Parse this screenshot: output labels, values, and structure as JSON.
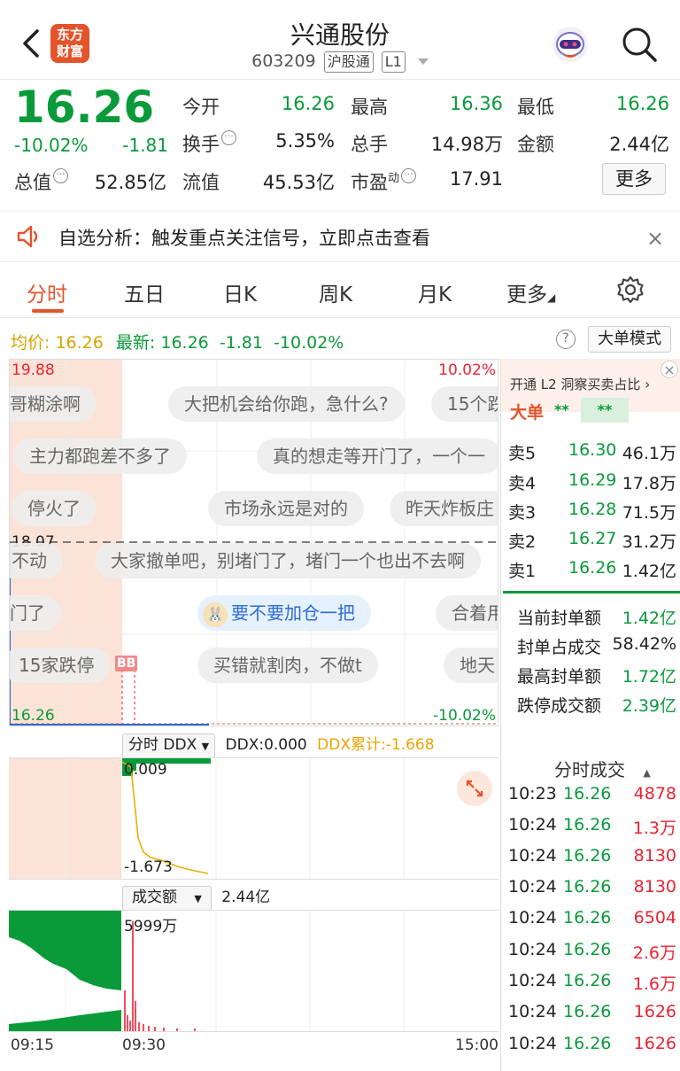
{
  "header": {
    "logo_text_1": "东方",
    "logo_text_2": "财富",
    "stock_name": "兴通股份",
    "stock_code": "603209",
    "tag_connect": "沪股通",
    "tag_level": "L1"
  },
  "quote": {
    "price": "16.26",
    "pct_change": "-10.02%",
    "change": "-1.81",
    "fields": [
      {
        "label": "今开",
        "value": "16.26"
      },
      {
        "label": "最高",
        "value": "16.36"
      },
      {
        "label": "最低",
        "value": "16.26"
      },
      {
        "label": "换手",
        "value": "5.35%"
      },
      {
        "label": "总手",
        "value": "14.98万"
      },
      {
        "label": "金额",
        "value": "2.44亿"
      },
      {
        "label": "总值",
        "value": "52.85亿"
      },
      {
        "label": "流值",
        "value": "45.53亿"
      },
      {
        "label": "市盈",
        "value": "17.91"
      }
    ],
    "pe_sup": "动",
    "more_label": "更多"
  },
  "alert": {
    "text": "自选分析：触发重点关注信号，立即点击查看",
    "close": "×"
  },
  "tabs": [
    {
      "label": "分时",
      "active": true
    },
    {
      "label": "五日"
    },
    {
      "label": "日K"
    },
    {
      "label": "周K"
    },
    {
      "label": "月K"
    },
    {
      "label": "更多"
    }
  ],
  "info_line": {
    "avg_label": "均价:",
    "avg_value": "16.26",
    "latest_label": "最新:",
    "latest_value": "16.26",
    "change": "-1.81",
    "pct": "-10.02%",
    "help": "?",
    "big_order_mode": "大单模式"
  },
  "chart": {
    "top_price": "19.88",
    "top_pct": "10.02%",
    "mid_price": "18.07",
    "bottom_price": "16.26",
    "bottom_pct": "-10.02%",
    "bb_marker": "BB",
    "comments": [
      "哥糊涂啊",
      "大把机会给你跑，急什么?",
      "15个跌",
      "主力都跑差不多了",
      "真的想走等开门了，一个一",
      "停火了",
      "市场永远是对的",
      "昨天炸板庄",
      "不动",
      "大家撤单吧，别堵门了，堵门一个也出不去啊",
      "门了",
      "要不要加仓一把",
      "合着用",
      "15家跌停",
      "买错就割肉，不做t",
      "地天"
    ],
    "ddx_select": "分时 DDX",
    "ddx_value": "DDX:0.000",
    "ddx_cum": "DDX累计:-1.668",
    "ddx_top": "0.009",
    "ddx_bottom": "-1.673",
    "vol_select": "成交额",
    "vol_total": "2.44亿",
    "vol_peak": "5999万",
    "time_start": "09:15",
    "time_open": "09:30",
    "time_end": "15:00"
  },
  "right_panel": {
    "l2_promo": "开通 L2 洞察买卖占比 ›",
    "big_order_label": "大单",
    "big_order_mask1": "**",
    "big_order_mask2": "**",
    "asks": [
      {
        "label": "卖5",
        "price": "16.30",
        "vol": "46.1万"
      },
      {
        "label": "卖4",
        "price": "16.29",
        "vol": "17.8万"
      },
      {
        "label": "卖3",
        "price": "16.28",
        "vol": "71.5万"
      },
      {
        "label": "卖2",
        "price": "16.27",
        "vol": "31.2万"
      },
      {
        "label": "卖1",
        "price": "16.26",
        "vol": "1.42亿"
      }
    ],
    "seal": [
      {
        "label": "当前封单额",
        "value": "1.42亿"
      },
      {
        "label": "封单占成交",
        "value": "58.42%"
      },
      {
        "label": "最高封单额",
        "value": "1.72亿"
      },
      {
        "label": "跌停成交额",
        "value": "2.39亿"
      }
    ],
    "trades_title": "分时成交",
    "trades": [
      {
        "time": "10:23",
        "price": "16.26",
        "vol": "4878",
        "color": "#e23"
      },
      {
        "time": "10:24",
        "price": "16.26",
        "vol": "1.3万",
        "color": "#e23"
      },
      {
        "time": "10:24",
        "price": "16.26",
        "vol": "8130",
        "color": "#e23"
      },
      {
        "time": "10:24",
        "price": "16.26",
        "vol": "8130",
        "color": "#e23"
      },
      {
        "time": "10:24",
        "price": "16.26",
        "vol": "6504",
        "color": "#e23"
      },
      {
        "time": "10:24",
        "price": "16.26",
        "vol": "2.6万",
        "color": "#e23"
      },
      {
        "time": "10:24",
        "price": "16.26",
        "vol": "1.6万",
        "color": "#e23"
      },
      {
        "time": "10:24",
        "price": "16.26",
        "vol": "1626",
        "color": "#e23"
      },
      {
        "time": "10:24",
        "price": "16.26",
        "vol": "1626",
        "color": "#e23"
      }
    ]
  },
  "colors": {
    "down": "#0a9a3a",
    "up": "#e23",
    "accent": "#e4542a"
  }
}
